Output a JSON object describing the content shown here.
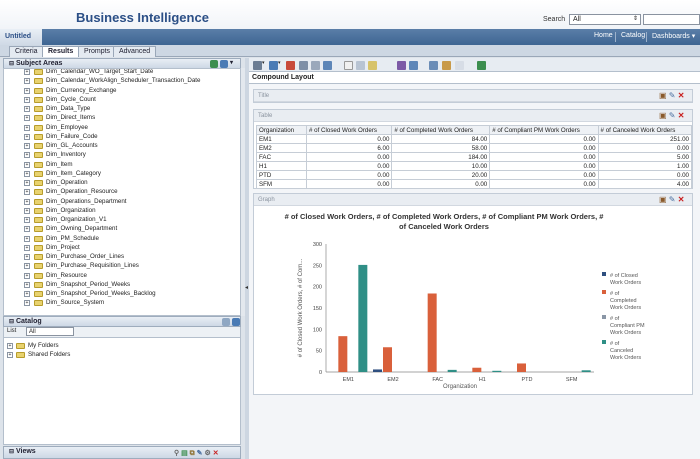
{
  "header": {
    "app_title": "Business Intelligence",
    "search_label": "Search",
    "search_scope": "All",
    "nav": [
      "Home",
      "Catalog",
      "Dashboards ▾"
    ]
  },
  "doc_tab": "Untitled",
  "subtabs": [
    "Criteria",
    "Results",
    "Prompts",
    "Advanced"
  ],
  "subject_areas": {
    "title": "Subject Areas",
    "items": [
      "Dim_Calendar_WO_Target_Start_Date",
      "Dim_Calendar_WorkAlign_Scheduler_Transaction_Date",
      "Dim_Currency_Exchange",
      "Dim_Cycle_Count",
      "Dim_Data_Type",
      "Dim_Direct_Items",
      "Dim_Employee",
      "Dim_Failure_Code",
      "Dim_GL_Accounts",
      "Dim_Inventory",
      "Dim_Item",
      "Dim_Item_Category",
      "Dim_Operation",
      "Dim_Operation_Resource",
      "Dim_Operations_Department",
      "Dim_Organization",
      "Dim_Organization_V1",
      "Dim_Owning_Department",
      "Dim_PM_Schedule",
      "Dim_Project",
      "Dim_Purchase_Order_Lines",
      "Dim_Purchase_Requisition_Lines",
      "Dim_Resource",
      "Dim_Snapshot_Period_Weeks",
      "Dim_Snapshot_Period_Weeks_Backlog",
      "Dim_Source_System"
    ]
  },
  "catalog": {
    "title": "Catalog",
    "list_label": "List",
    "list_value": "All",
    "folders": [
      "My Folders",
      "Shared Folders"
    ]
  },
  "views": {
    "title": "Views"
  },
  "compound_layout": "Compound Layout",
  "title_view": "Title",
  "table_view": {
    "label": "Table",
    "headers": [
      "Organization",
      "# of Closed Work Orders",
      "# of Completed Work Orders",
      "# of Compliant PM Work Orders",
      "# of Canceled Work Orders"
    ],
    "rows": [
      [
        "EM1",
        "0.00",
        "84.00",
        "0.00",
        "251.00"
      ],
      [
        "EM2",
        "6.00",
        "58.00",
        "0.00",
        "0.00"
      ],
      [
        "FAC",
        "0.00",
        "184.00",
        "0.00",
        "5.00"
      ],
      [
        "H1",
        "0.00",
        "10.00",
        "0.00",
        "1.00"
      ],
      [
        "PTD",
        "0.00",
        "20.00",
        "0.00",
        "0.00"
      ],
      [
        "SFM",
        "0.00",
        "0.00",
        "0.00",
        "4.00"
      ]
    ]
  },
  "graph_view": {
    "label": "Graph"
  },
  "chart_data": {
    "type": "bar",
    "title": "# of Closed Work Orders, # of Completed Work Orders, # of Compliant PM Work Orders, # of Canceled Work Orders",
    "xlabel": "Organization",
    "ylabel": "# of Closed Work Orders, # of Com...",
    "ylim": [
      0,
      300
    ],
    "yticks": [
      "0",
      "50",
      "100",
      "150",
      "200",
      "250",
      "300"
    ],
    "categories": [
      "EM1",
      "EM2",
      "FAC",
      "H1",
      "PTD",
      "SFM"
    ],
    "series": [
      {
        "name": "# of Closed Work Orders",
        "color": "#2f4f7f",
        "values": [
          0,
          6,
          0,
          0,
          0,
          0
        ]
      },
      {
        "name": "# of Completed Work Orders",
        "color": "#d9603b",
        "values": [
          84,
          58,
          184,
          10,
          20,
          0
        ]
      },
      {
        "name": "# of Compliant PM Work Orders",
        "color": "#8a96a6",
        "values": [
          0,
          0,
          0,
          0,
          0,
          0
        ]
      },
      {
        "name": "# of Canceled Work Orders",
        "color": "#2f8f86",
        "values": [
          251,
          0,
          5,
          1,
          0,
          4
        ]
      }
    ],
    "legend_labels": [
      [
        "# of Closed",
        "Work Orders"
      ],
      [
        "# of",
        "Completed",
        "Work Orders"
      ],
      [
        "# of",
        "Compliant PM",
        "Work Orders"
      ],
      [
        "# of",
        "Canceled",
        "Work Orders"
      ]
    ],
    "grid": false,
    "legend_position": "right"
  }
}
